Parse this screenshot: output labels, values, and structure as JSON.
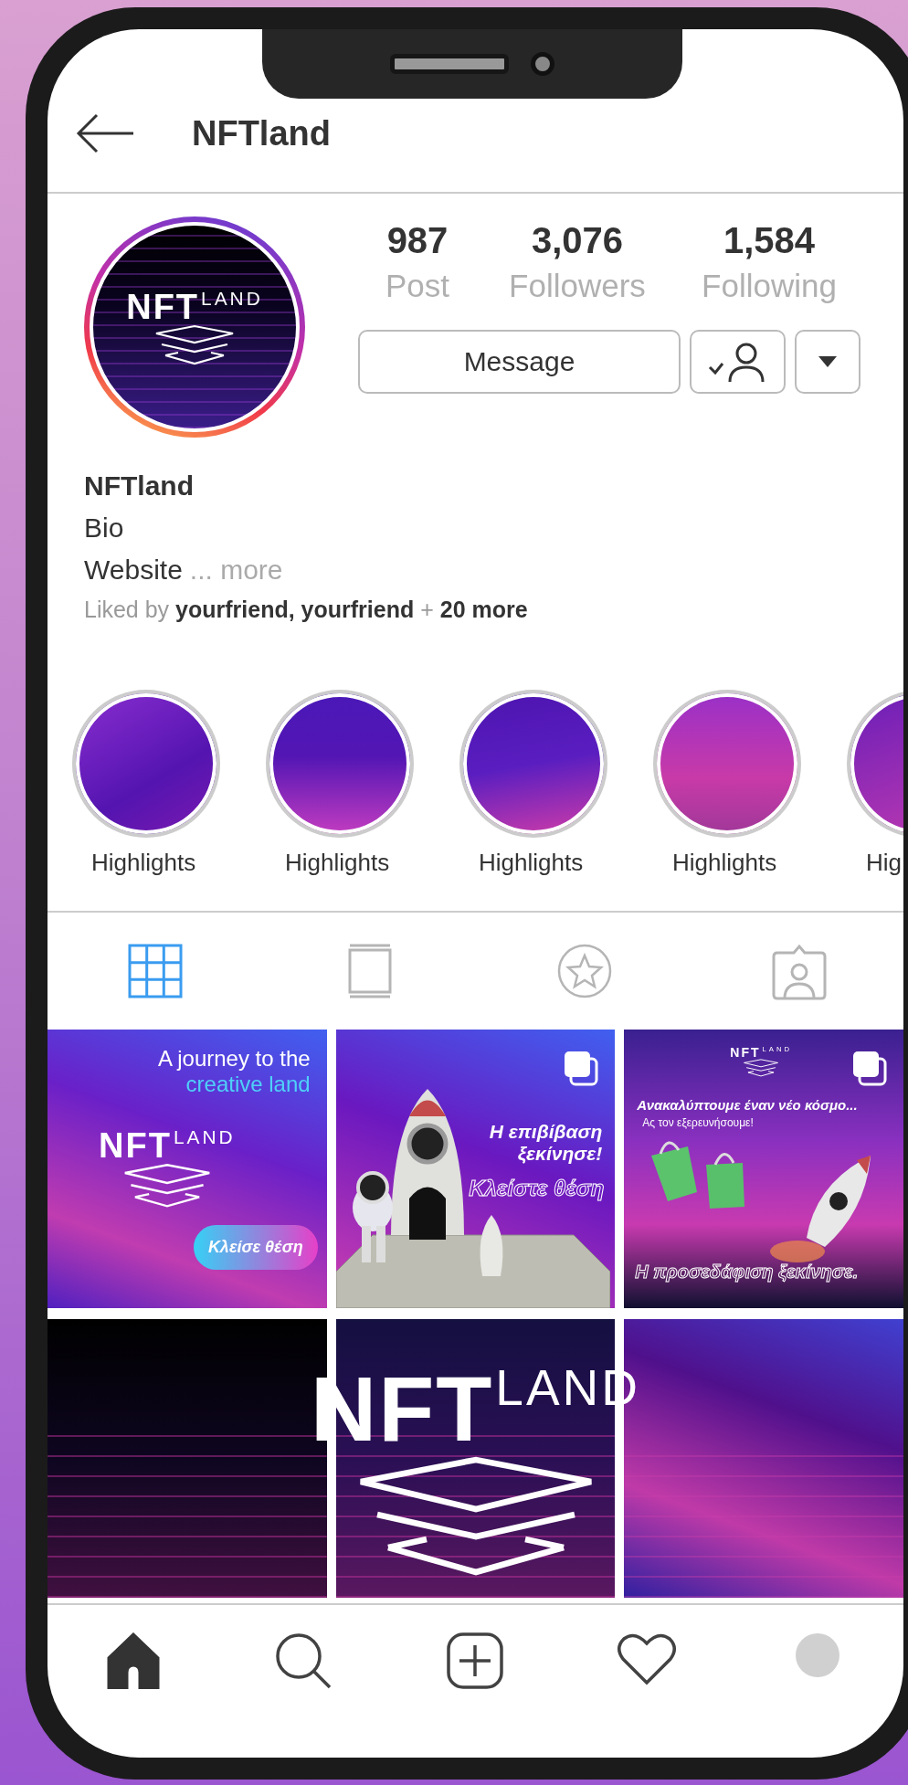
{
  "header": {
    "title": "NFTland"
  },
  "profile": {
    "avatar_logo": {
      "main": "NFT",
      "sub": "LAND"
    },
    "stats": [
      {
        "value": "987",
        "label": "Post"
      },
      {
        "value": "3,076",
        "label": "Followers"
      },
      {
        "value": "1,584",
        "label": "Following"
      }
    ],
    "message_button": "Message",
    "name": "NFTland",
    "bio": "Bio",
    "website": "Website",
    "website_more": "... more",
    "liked_by": {
      "prefix": "Liked by",
      "names": "yourfriend, yourfriend",
      "plus": "+",
      "count": "20 more"
    }
  },
  "highlights": [
    {
      "label": "Highlights"
    },
    {
      "label": "Highlights"
    },
    {
      "label": "Highlights"
    },
    {
      "label": "Highlights"
    },
    {
      "label": "Hig"
    }
  ],
  "tabs": [
    {
      "kind": "grid",
      "selected": true
    },
    {
      "kind": "feed",
      "selected": false
    },
    {
      "kind": "starred",
      "selected": false
    },
    {
      "kind": "tagged",
      "selected": false
    }
  ],
  "posts": [
    {
      "kind": "journey",
      "multiple": false,
      "headline": "A journey to the",
      "accent": "creative land",
      "logo": {
        "main": "NFT",
        "sub": "LAND"
      },
      "cta": "Κλείσε θέση"
    },
    {
      "kind": "rocket",
      "multiple": true,
      "headline": "Η επιβίβαση ξεκίνησε!",
      "subline": "Κλείστε θέση"
    },
    {
      "kind": "landing",
      "multiple": true,
      "logo": {
        "main": "NFT",
        "sub": "LAND"
      },
      "headline": "Ανακαλύπτουμε έναν νέο κόσμο...",
      "subline": "Ας τον εξερευνήσουμε!",
      "footer": "Η προσεδάφιση ξεκίνησε."
    }
  ],
  "banner": {
    "logo": {
      "main": "NFT",
      "sub": "LAND"
    }
  },
  "bottom_nav": [
    {
      "kind": "home",
      "selected": true
    },
    {
      "kind": "search",
      "selected": false
    },
    {
      "kind": "add",
      "selected": false
    },
    {
      "kind": "heart",
      "selected": false
    },
    {
      "kind": "profile",
      "selected": false
    }
  ]
}
